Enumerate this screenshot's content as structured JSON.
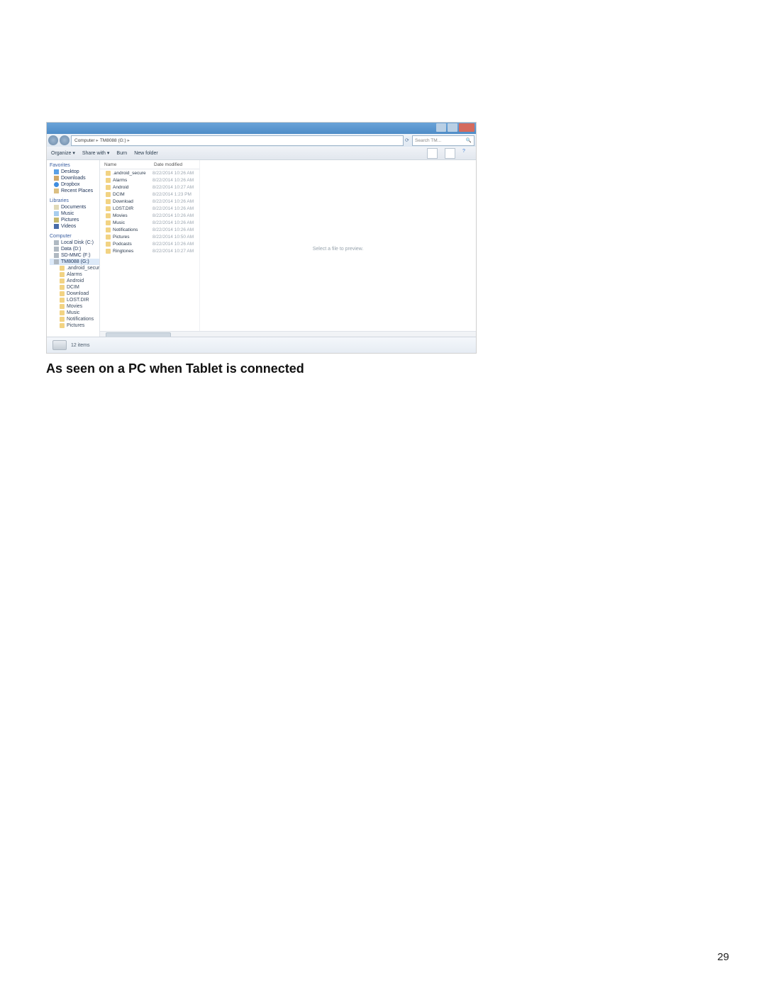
{
  "caption": "As seen on a PC when Tablet is connected",
  "page_number": "29",
  "window": {
    "breadcrumb": [
      "Computer",
      "TM8088 (G:)"
    ],
    "search_placeholder": "Search TM...",
    "toolbar": {
      "organize": "Organize ▾",
      "share": "Share with ▾",
      "burn": "Burn",
      "newfolder": "New folder"
    },
    "columns": {
      "name": "Name",
      "date": "Date modified"
    },
    "nav": {
      "favorites": "Favorites",
      "favorites_items": [
        "Desktop",
        "Downloads",
        "Dropbox",
        "Recent Places"
      ],
      "libraries": "Libraries",
      "libraries_items": [
        "Documents",
        "Music",
        "Pictures",
        "Videos"
      ],
      "computer": "Computer",
      "computer_items": [
        "Local Disk (C:)",
        "Data (D:)",
        "SD-MMC (F:)",
        "TM8088 (G:)"
      ],
      "device_items": [
        ".android_secure",
        "Alarms",
        "Android",
        "DCIM",
        "Download",
        "LOST.DIR",
        "Movies",
        "Music",
        "Notifications",
        "Pictures"
      ]
    },
    "files": [
      {
        "name": ".android_secure",
        "date": "8/22/2014 10:26 AM"
      },
      {
        "name": "Alarms",
        "date": "8/22/2014 10:26 AM"
      },
      {
        "name": "Android",
        "date": "8/22/2014 10:27 AM"
      },
      {
        "name": "DCIM",
        "date": "8/22/2014 1:23 PM"
      },
      {
        "name": "Download",
        "date": "8/22/2014 10:26 AM"
      },
      {
        "name": "LOST.DIR",
        "date": "8/22/2014 10:26 AM"
      },
      {
        "name": "Movies",
        "date": "8/22/2014 10:26 AM"
      },
      {
        "name": "Music",
        "date": "8/22/2014 10:26 AM"
      },
      {
        "name": "Notifications",
        "date": "8/22/2014 10:26 AM"
      },
      {
        "name": "Pictures",
        "date": "8/22/2014 10:50 AM"
      },
      {
        "name": "Podcasts",
        "date": "8/22/2014 10:26 AM"
      },
      {
        "name": "Ringtones",
        "date": "8/22/2014 10:27 AM"
      }
    ],
    "preview_hint": "Select a file to preview.",
    "status": "12 items"
  }
}
